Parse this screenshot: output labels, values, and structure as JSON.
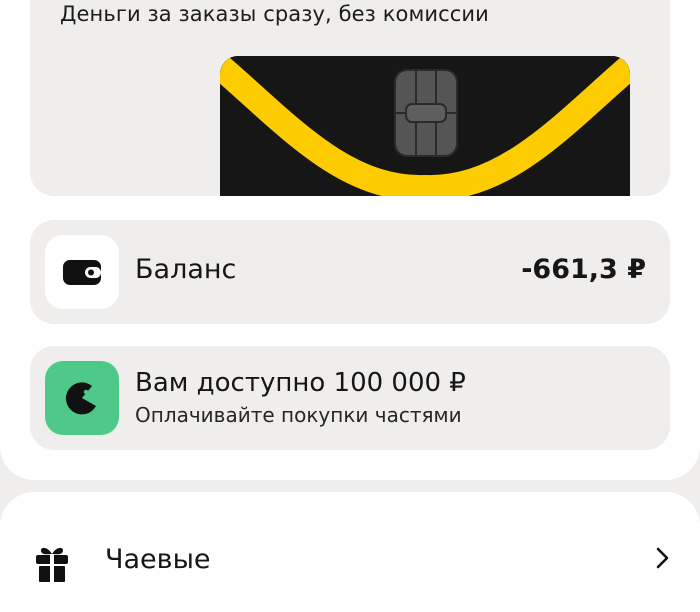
{
  "promo": {
    "text": "Деньги за заказы сразу, без комиссии"
  },
  "balance": {
    "label": "Баланс",
    "value": "-661,3 ₽",
    "icon": "wallet-icon"
  },
  "credit": {
    "title": "Вам доступно 100 000 ₽",
    "subtitle": "Оплачивайте покупки частями",
    "icon": "split-pay-icon"
  },
  "menu": {
    "tips_label": "Чаевые",
    "tips_icon": "gift-icon",
    "chevron_icon": "chevron-right-icon"
  },
  "colors": {
    "background": "#efeeec",
    "surface": "#ffffff",
    "card_black": "#161616",
    "card_yellow": "#fccc00",
    "split_green": "#4fc987"
  }
}
